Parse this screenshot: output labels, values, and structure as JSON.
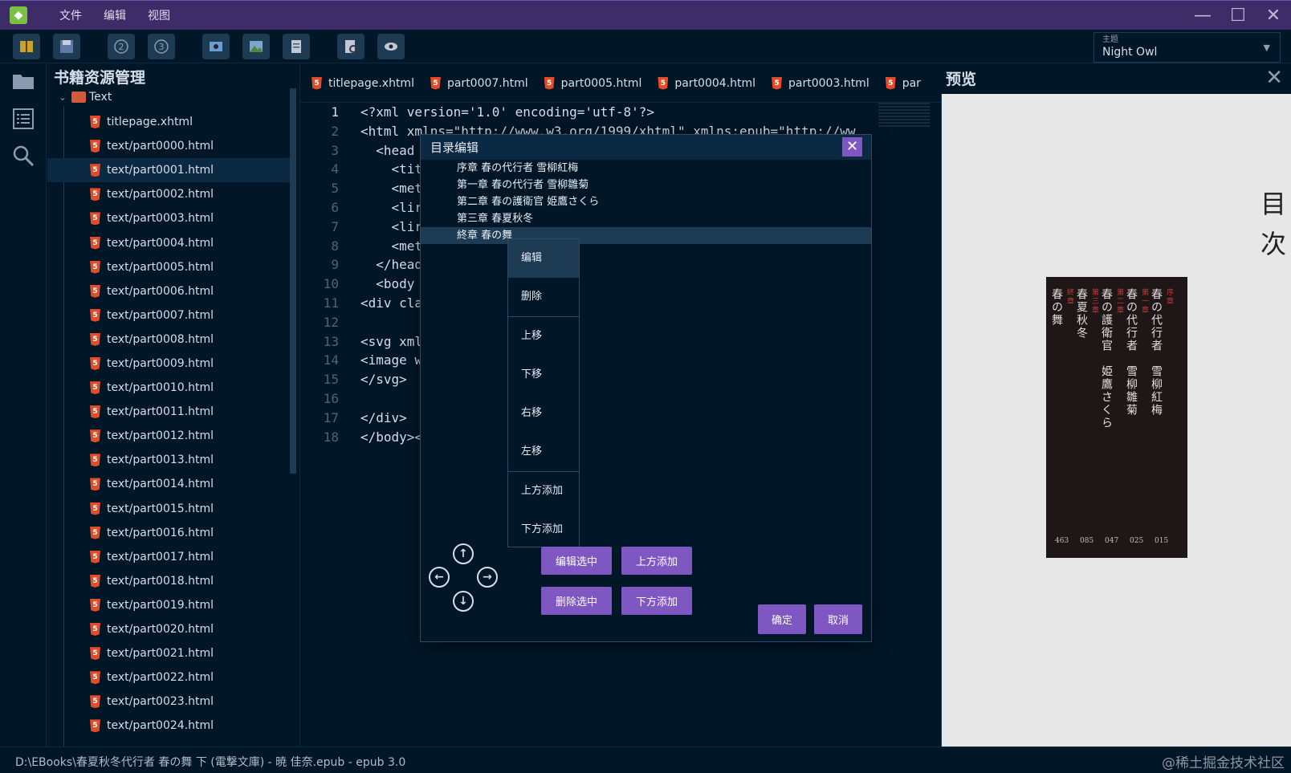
{
  "menu": [
    "文件",
    "编辑",
    "视图"
  ],
  "window": {
    "min": "—",
    "max": "☐",
    "close": "✕"
  },
  "theme": {
    "label": "主题",
    "value": "Night Owl"
  },
  "sidebar": {
    "title": "书籍资源管理",
    "root": "Text",
    "files": [
      "titlepage.xhtml",
      "text/part0000.html",
      "text/part0001.html",
      "text/part0002.html",
      "text/part0003.html",
      "text/part0004.html",
      "text/part0005.html",
      "text/part0006.html",
      "text/part0007.html",
      "text/part0008.html",
      "text/part0009.html",
      "text/part0010.html",
      "text/part0011.html",
      "text/part0012.html",
      "text/part0013.html",
      "text/part0014.html",
      "text/part0015.html",
      "text/part0016.html",
      "text/part0017.html",
      "text/part0018.html",
      "text/part0019.html",
      "text/part0020.html",
      "text/part0021.html",
      "text/part0022.html",
      "text/part0023.html",
      "text/part0024.html"
    ]
  },
  "tabs": [
    "titlepage.xhtml",
    "part0007.html",
    "part0005.html",
    "part0004.html",
    "part0003.html",
    "par"
  ],
  "code": {
    "lines": [
      "1",
      "2",
      "3",
      "4",
      "5",
      "6",
      "7",
      "8",
      "9",
      "10",
      "11",
      "12",
      "13",
      "14",
      "15",
      "16",
      "17",
      "18"
    ],
    "l1": "<?xml version='1.0' encoding='utf-8'?>",
    "l2": "<html xmlns=\"http://www.w3.org/1999/xhtml\" xmlns:epub=\"http://ww",
    "l3": "  <head",
    "l4": "    <tit",
    "l5": "    <met",
    "l6": "    <lir",
    "l7": "    <lir",
    "l8": "    <met",
    "l9": "  </head",
    "l10": "  <body",
    "l11": "<div cla",
    "l13": "<svg xml",
    "l14": "<image w",
    "l15": "</svg>",
    "l17": "</div>",
    "l18": "</body><"
  },
  "preview": {
    "title": "预览",
    "close": "✕",
    "toc_heading": "目次",
    "entries": [
      {
        "chap": "序章",
        "title": "春の代行者　雪柳紅梅",
        "page": "015"
      },
      {
        "chap": "第一章",
        "title": "春の代行者　雪柳雛菊",
        "page": "025"
      },
      {
        "chap": "第二章",
        "title": "春の護衛官　姫鷹さくら",
        "page": "047"
      },
      {
        "chap": "第三章",
        "title": "春夏秋冬",
        "page": "085"
      },
      {
        "chap": "終章",
        "title": "春の舞",
        "page": "463"
      }
    ]
  },
  "dialog": {
    "title": "目录编辑",
    "close": "✕",
    "items": [
      "序章 春の代行者 雪柳紅梅",
      "第一章 春の代行者 雪柳雛菊",
      "第二章 春の護衛官 姫鷹さくら",
      "第三章 春夏秋冬",
      "終章 春の舞"
    ],
    "context_menu": [
      "编辑",
      "删除",
      "上移",
      "下移",
      "右移",
      "左移",
      "上方添加",
      "下方添加"
    ],
    "buttons": {
      "edit_selected": "编辑选中",
      "add_above": "上方添加",
      "delete_selected": "删除选中",
      "add_below": "下方添加",
      "ok": "确定",
      "cancel": "取消"
    },
    "arrows": {
      "up": "↑",
      "left": "←",
      "right": "→",
      "down": "↓"
    }
  },
  "status": "D:\\EBooks\\春夏秋冬代行者 春の舞 下 (電撃文庫) - 暁 佳奈.epub - epub 3.0",
  "watermark": "@稀土掘金技术社区",
  "colors": {
    "titlebar": "#3e2c68",
    "background": "#011627",
    "accent": "#7e57c2",
    "html_icon": "#e34c26"
  }
}
